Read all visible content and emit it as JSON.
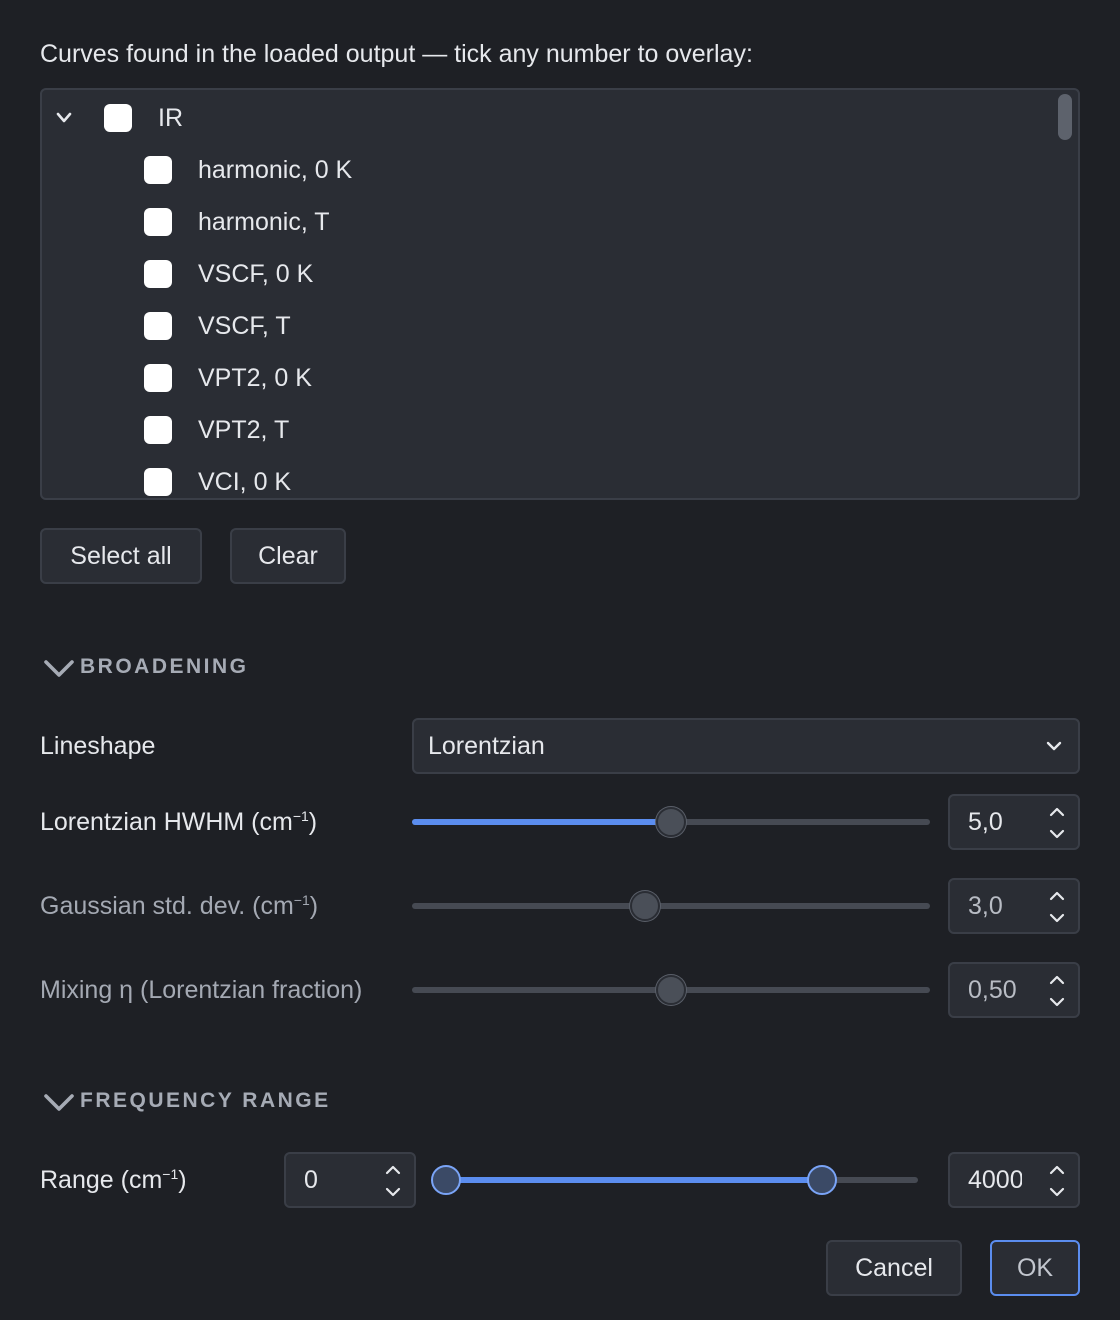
{
  "intro_text": "Curves found in the loaded output — tick any number to overlay:",
  "tree": {
    "root": {
      "label": "IR",
      "checked": false,
      "expanded": true,
      "icon": "chevron-down-icon"
    },
    "items": [
      {
        "label": "harmonic, 0 K",
        "checked": false
      },
      {
        "label": "harmonic, T",
        "checked": false
      },
      {
        "label": "VSCF, 0 K",
        "checked": false
      },
      {
        "label": "VSCF, T",
        "checked": false
      },
      {
        "label": "VPT2, 0 K",
        "checked": false
      },
      {
        "label": "VPT2, T",
        "checked": false
      },
      {
        "label": "VCI, 0 K",
        "checked": false
      }
    ]
  },
  "buttons": {
    "select_all": "Select all",
    "clear": "Clear"
  },
  "broadening": {
    "heading": "BROADENING",
    "lineshape": {
      "label": "Lineshape",
      "value": "Lorentzian"
    },
    "lorentzian": {
      "label_main": "Lorentzian HWHM (cm",
      "label_sup": "−1",
      "label_end": ")",
      "value": "5,0",
      "slider_fraction": 0.5,
      "enabled": true
    },
    "gaussian": {
      "label_main": "Gaussian std. dev. (cm",
      "label_sup": "−1",
      "label_end": ")",
      "value": "3,0",
      "slider_fraction": 0.45,
      "enabled": false
    },
    "mixing": {
      "label": "Mixing η (Lorentzian fraction)",
      "value": "0,50",
      "slider_fraction": 0.5,
      "enabled": false
    }
  },
  "frequency_range": {
    "heading": "FREQUENCY RANGE",
    "label_main": "Range (cm",
    "label_sup": "−1",
    "label_end": ")",
    "min_value": "0",
    "max_value": "4000",
    "low_fraction": 0.0,
    "high_fraction": 0.79
  },
  "footer": {
    "cancel": "Cancel",
    "ok": "OK"
  },
  "colors": {
    "accent": "#5b8def",
    "background": "#1e2025",
    "panel": "#2a2d34"
  }
}
